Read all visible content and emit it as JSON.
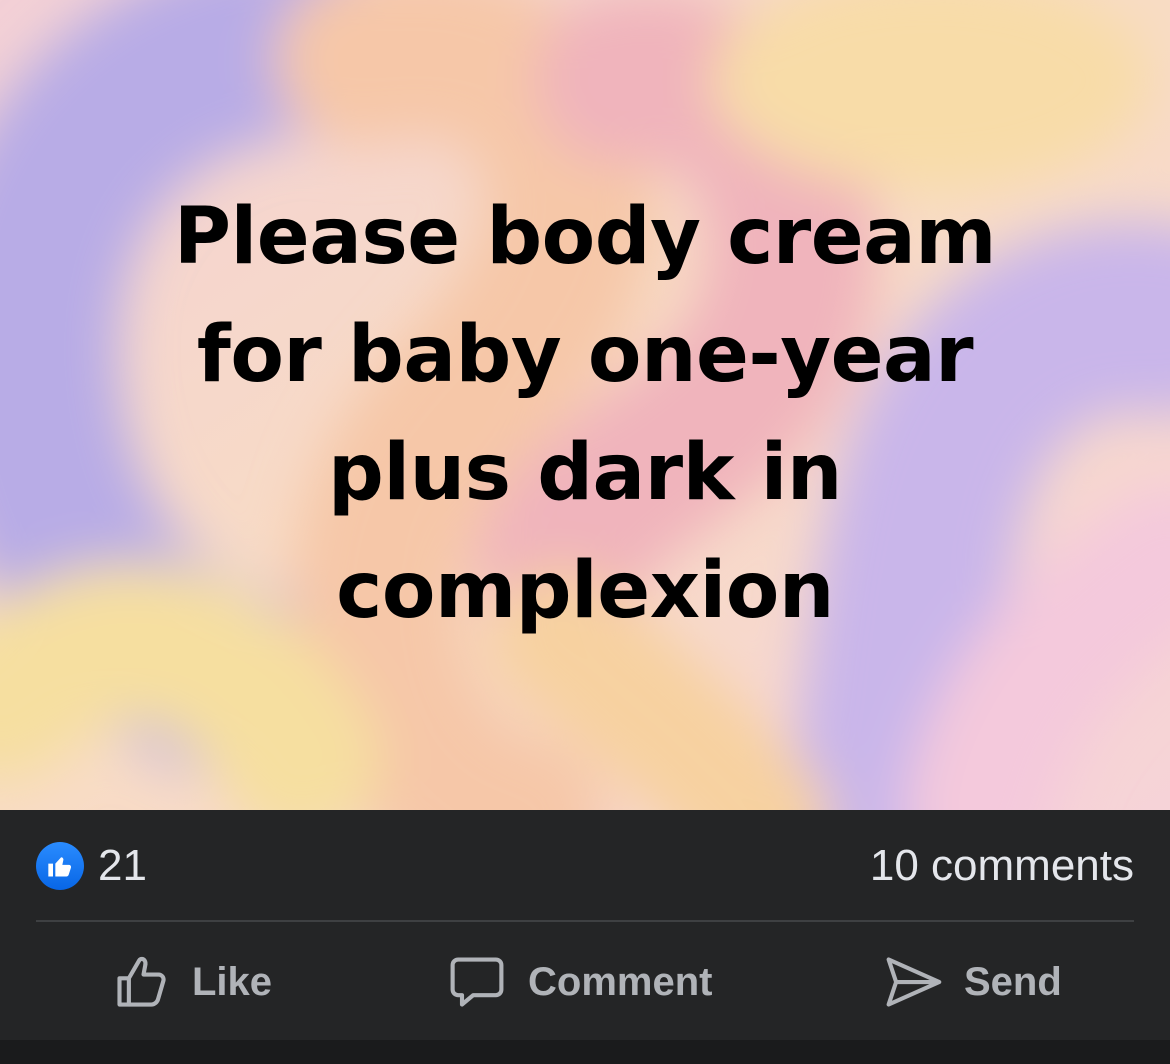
{
  "post": {
    "text_lines": [
      "Please body cream",
      "for baby one-year",
      "plus dark in",
      "complexion"
    ],
    "background_colors": {
      "base": "#f7d6c8",
      "lavender": "#b9aee6",
      "peach": "#f7c9a6",
      "yellow": "#f6dfa0",
      "pink": "#f2b8c6"
    },
    "text_color": "#000000"
  },
  "reactions": {
    "icon": "like-thumbs-up-icon",
    "count": "21",
    "comments_label": "10 comments"
  },
  "actions": {
    "like_label": "Like",
    "comment_label": "Comment",
    "send_label": "Send",
    "like_icon": "thumbs-up-outline-icon",
    "comment_icon": "speech-bubble-icon",
    "send_icon": "paper-plane-icon"
  },
  "theme": {
    "footer_bg": "#242526",
    "text_primary": "#e4e6eb",
    "text_secondary": "#b0b3b8",
    "accent": "#1877f2",
    "divider": "#3e4042"
  }
}
